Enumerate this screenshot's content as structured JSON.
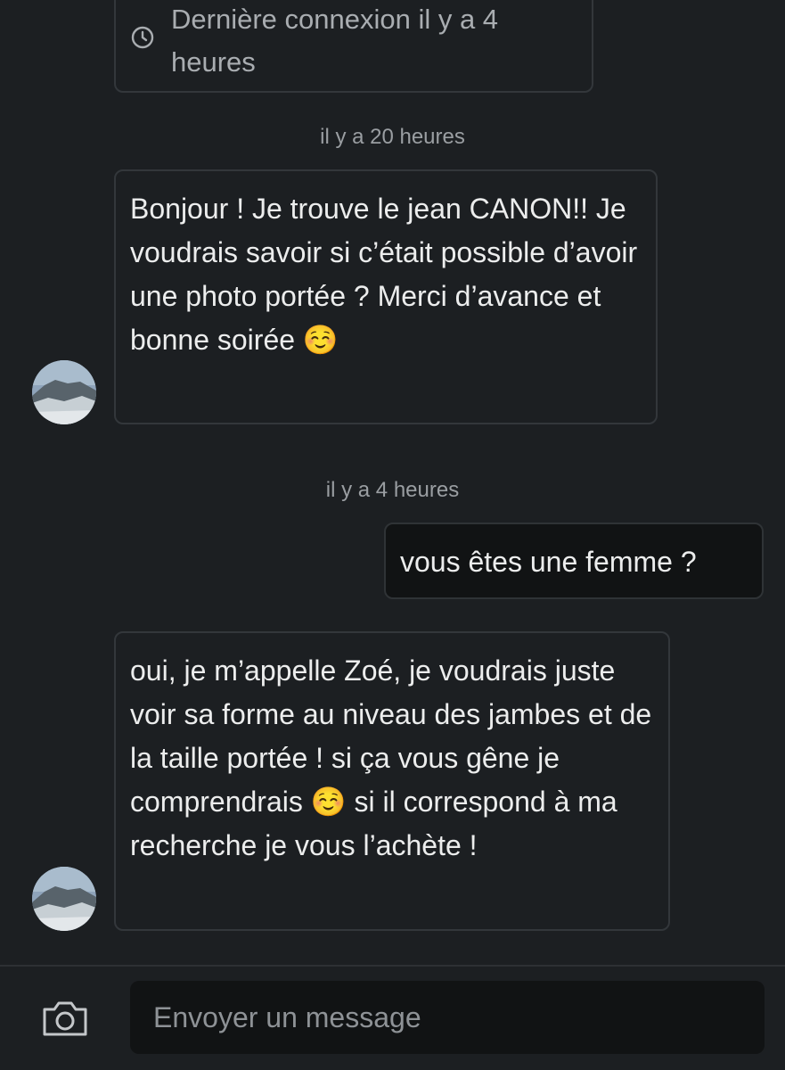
{
  "status_card": {
    "icon": "clock-icon",
    "text": "Dernière connexion il y a 4 heures"
  },
  "messages": [
    {
      "timestamp": "il y a 20 heures",
      "direction": "incoming",
      "text": "Bonjour ! Je trouve le jean CANON!! Je voudrais savoir si c’était possible d’avoir une photo portée ? Merci d’avance et bonne soirée ☺️"
    },
    {
      "timestamp": "il y a 4 heures",
      "direction": "outgoing",
      "text": "vous êtes une femme ?"
    },
    {
      "direction": "incoming",
      "text": "oui, je m’appelle Zoé, je voudrais juste voir sa forme au niveau des jambes et de la taille portée ! si ça vous gêne je comprendrais ☺️ si il correspond à ma recherche je vous l’achète !"
    }
  ],
  "composer": {
    "camera_icon": "camera-icon",
    "placeholder": "Envoyer un message"
  },
  "colors": {
    "background": "#1c1f22",
    "bubble_border": "#33373b",
    "outgoing_bubble": "#111314",
    "muted_text": "#9a9ea2"
  }
}
